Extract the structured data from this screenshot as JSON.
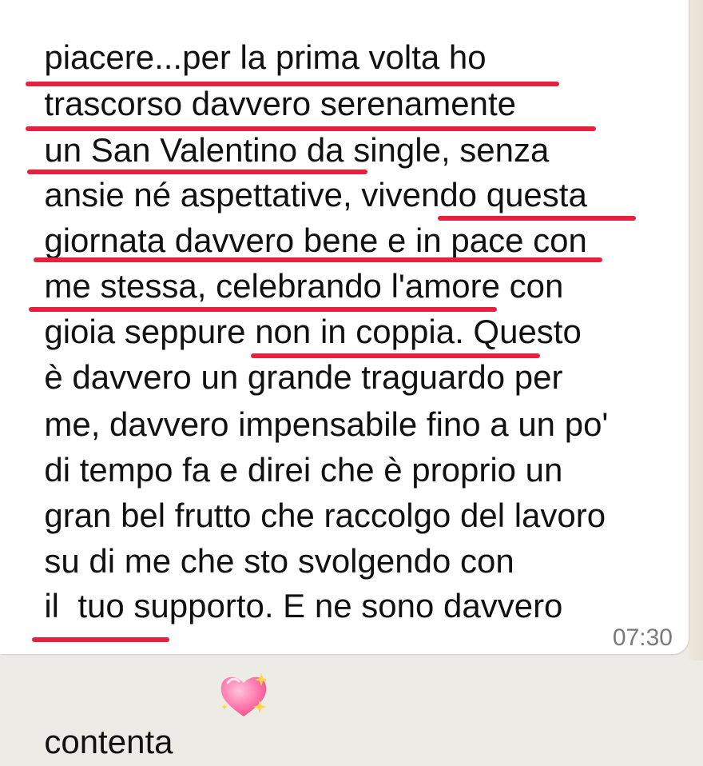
{
  "message": {
    "lines": [
      {
        "parts": [
          "piacere...per la prima volta ho"
        ]
      },
      {
        "parts": [
          "trascorso davvero serenamente"
        ]
      },
      {
        "parts": [
          "un San Valentino da single, senza"
        ]
      },
      {
        "parts": [
          "ansie né aspettative",
          ", vivendo questa"
        ]
      },
      {
        "parts": [
          "giornata davvero bene e ",
          "in pace con"
        ]
      },
      {
        "parts": [
          "me stessa, celebrando l'amore con"
        ]
      },
      {
        "parts": [
          "gioia seppure non in coppia",
          ". Questo"
        ]
      },
      {
        "parts": [
          "è davvero un ",
          "grande traguardo",
          " per"
        ]
      },
      {
        "parts": [
          "me, davvero impensabile fino a un po'"
        ]
      },
      {
        "parts": [
          "di tempo fa e direi che è proprio un"
        ]
      },
      {
        "parts": [
          "gran bel frutto che raccolgo del lavoro"
        ]
      },
      {
        "parts": [
          "su di me che sto svolgendo con"
        ]
      },
      {
        "parts": [
          "il  tuo supporto. E ne sono davvero"
        ]
      },
      {
        "parts": [
          "contenta"
        ]
      }
    ],
    "emoji_icon": "sparkling-heart-icon",
    "time": "07:30"
  },
  "colors": {
    "underline": "#e4223f",
    "bubble": "#ffffff",
    "text": "#111111",
    "time": "#7a7a7a"
  }
}
